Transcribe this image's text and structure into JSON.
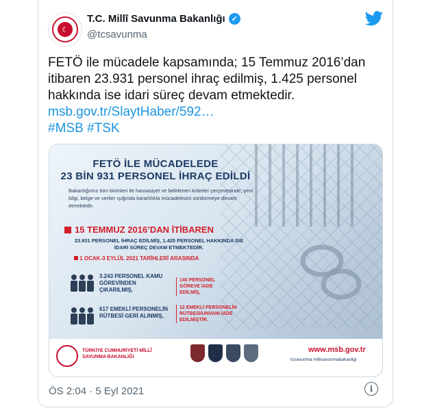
{
  "tweet": {
    "author_name": "T.C. Millî Savunma Bakanlığı",
    "handle": "@tcsavunma",
    "text": "FETÖ ile mücadele kapsamında; 15 Temmuz 2016’dan itibaren 23.931 personel ihraç edilmiş, 1.425 personel hakkında ise idari süreç devam etmektedir.",
    "link": "msb.gov.tr/SlaytHaber/592…",
    "hashtags": "#MSB #TSK",
    "timestamp": "ÖS 2:04 · 5 Eyl 2021",
    "info_glyph": "i"
  },
  "infographic": {
    "title_line1": "FETÖ İLE MÜCADELEDE",
    "title_line2": "23 BİN 931 PERSONEL İHRAÇ EDİLDİ",
    "intro": "Bakanlığımız tüm birimleri ile hassasiyet ve belirlenen kriterler çerçevesinde; yeni bilgi, belge ve veriler ışığında kararlılıkla mücadelesini sürdürmeye devam etmektedir.",
    "section_title": "15 TEMMUZ 2016’DAN İTİBAREN",
    "section_text": "23.931 PERSONEL İHRAÇ EDİLMİŞ, 1.425 PERSONEL HAKKINDA İSE İDARİ SÜREÇ DEVAM ETMEKTEDİR.",
    "date_range": "1 OCAK-3 EYLÜL 2021 TARİHLERİ ARASINDA",
    "stat1": "3.243 PERSONEL KAMU GÖREVİNDEN ÇIKARILMIŞ,",
    "stat2": "617 EMEKLİ PERSONELİN RÜTBESİ GERİ ALINMIŞ,",
    "note1": "140 PERSONEL GÖREVE İADE EDİLMİŞ,",
    "note2": "12 EMEKLİ PERSONELİN RÜTBESİ/UNVANI İADE EDİLMİŞTİR.",
    "footer_title": "TÜRKİYE CUMHURİYETİ MİLLÎ SAVUNMA BAKANLIĞI",
    "website": "www.msb.gov.tr",
    "social": "tcsavunma  millisavunmabakanligi"
  },
  "colors": {
    "accent": "#1d9bf0",
    "link": "#1b95e0",
    "navy": "#1b3a63",
    "red": "#d21f2a"
  },
  "icons": [
    "verified-badge-icon",
    "twitter-bird-icon",
    "info-icon",
    "people-icon",
    "handcuffs-icon"
  ]
}
